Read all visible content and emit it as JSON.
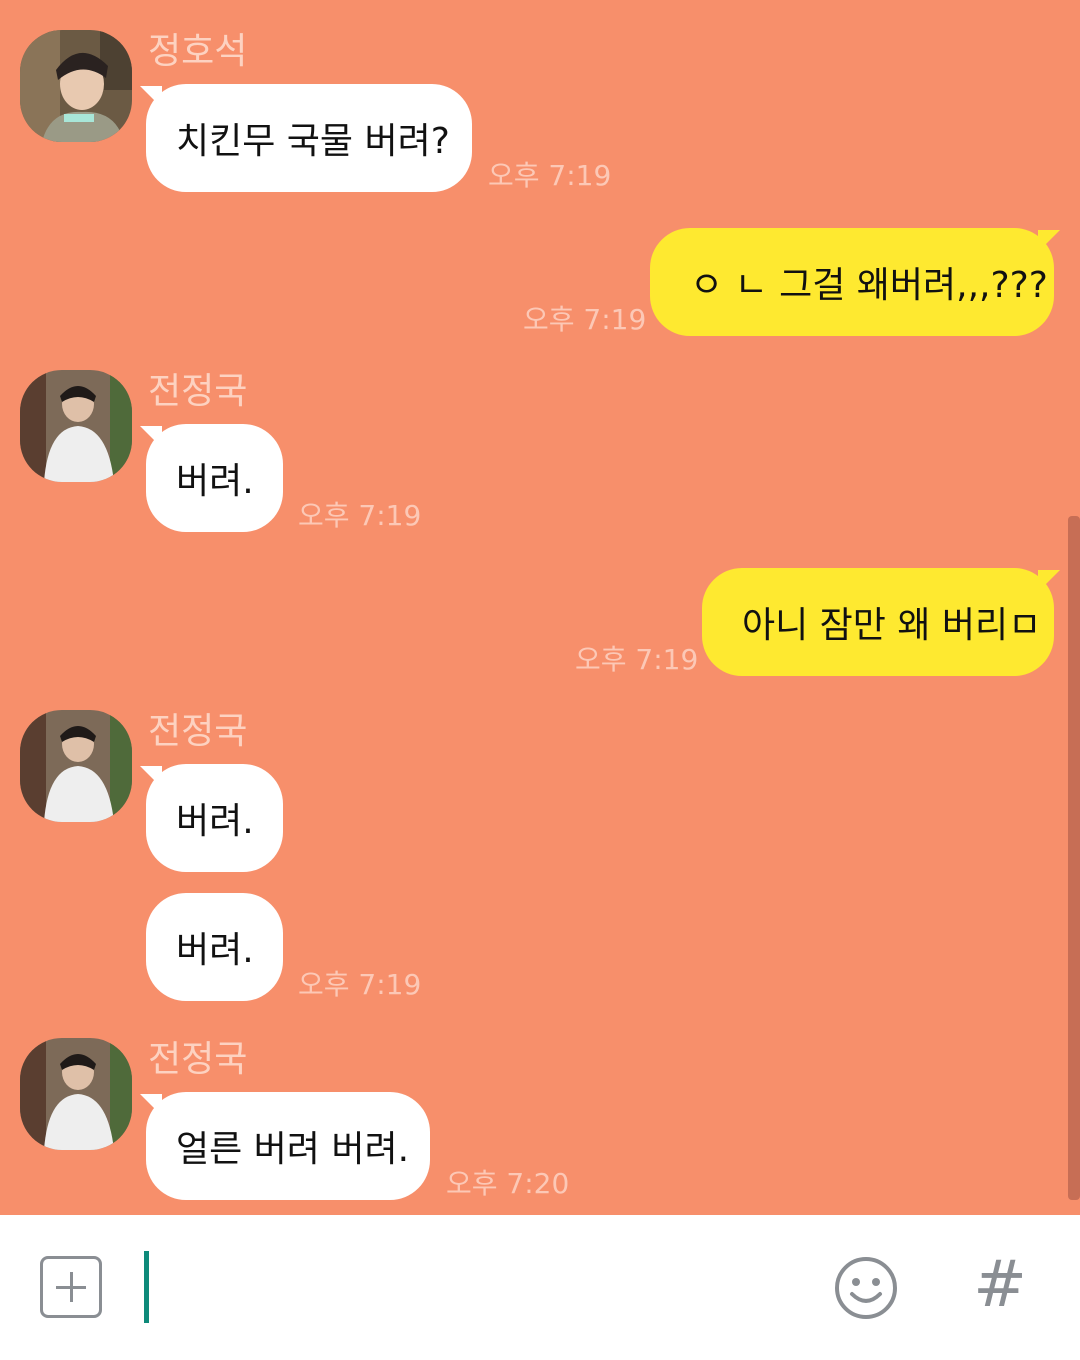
{
  "messages": [
    {
      "sender": "정호석",
      "avatar_icon": "avatar-jung-hoseok-icon",
      "text": "치킨무 국물 버려?",
      "time": "오후 7:19",
      "direction": "incoming"
    },
    {
      "sender": "",
      "text": "ㅇ ㄴ 그걸 왜버려,,,???",
      "time": "오후 7:19",
      "direction": "outgoing"
    },
    {
      "sender": "전정국",
      "avatar_icon": "avatar-jeon-jungkook-icon",
      "text": "버려.",
      "time": "오후 7:19",
      "direction": "incoming"
    },
    {
      "sender": "",
      "text": "아니 잠만 왜 버리ㅁ",
      "time": "오후 7:19",
      "direction": "outgoing"
    },
    {
      "sender": "전정국",
      "avatar_icon": "avatar-jeon-jungkook-icon",
      "text": "버려.",
      "time": "",
      "direction": "incoming"
    },
    {
      "sender": "",
      "text": "버려.",
      "time": "오후 7:19",
      "direction": "incoming"
    },
    {
      "sender": "전정국",
      "avatar_icon": "avatar-jeon-jungkook-icon",
      "text": "얼른 버려 버려.",
      "time": "오후 7:20",
      "direction": "incoming"
    }
  ],
  "input_bar": {
    "value": "",
    "plus_icon": "plus-icon",
    "emoji_icon": "smiley-icon",
    "hashtag_label": "#"
  },
  "colors": {
    "background": "#f78f6b",
    "incoming_bubble": "#ffffff",
    "outgoing_bubble": "#fee930",
    "name_text": "#fdd2c1",
    "time_text": "#fcc8b6",
    "caret": "#0e8a7a"
  }
}
